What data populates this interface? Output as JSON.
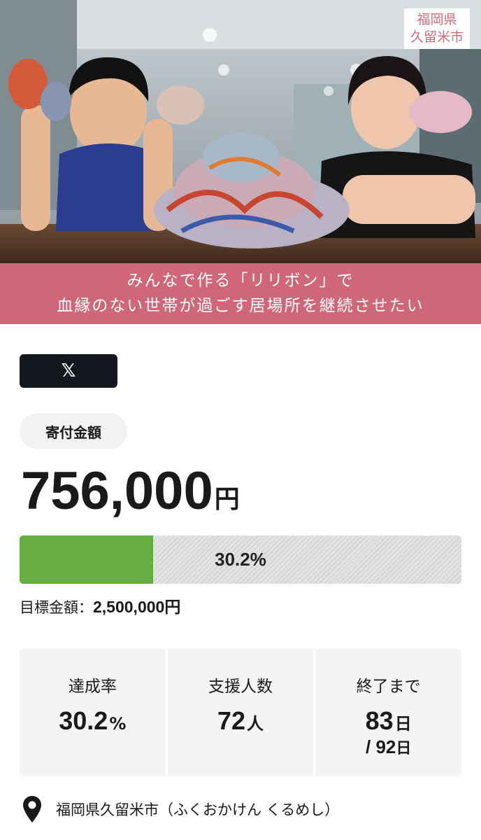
{
  "hero": {
    "region_badge": [
      "福岡県",
      "久留米市"
    ],
    "tagline": [
      "みんなで作る「リリボン」で",
      "血縁のない世帯が過ごす居場所を継続させたい"
    ]
  },
  "share": {
    "x_label": "𝕏"
  },
  "donation": {
    "label": "寄付金額",
    "amount": "756,000",
    "unit": "円",
    "progress_percent": 30.2,
    "progress_text": "30.2%",
    "target_label": "目標金額：",
    "target_value": "2,500,000円"
  },
  "stats": {
    "achievement": {
      "label": "達成率",
      "value": "30.2",
      "unit": "%"
    },
    "supporters": {
      "label": "支援人数",
      "value": "72",
      "unit": "人"
    },
    "remaining": {
      "label": "終了まで",
      "value": "83",
      "unit": "日",
      "total_prefix": "/ ",
      "total": "92",
      "total_unit": "日"
    }
  },
  "location": {
    "text": "福岡県久留米市（ふくおかけん くるめし）"
  },
  "colors": {
    "accent_pink": "#cf6778",
    "progress_green": "#66ad43",
    "x_button": "#15191f"
  }
}
